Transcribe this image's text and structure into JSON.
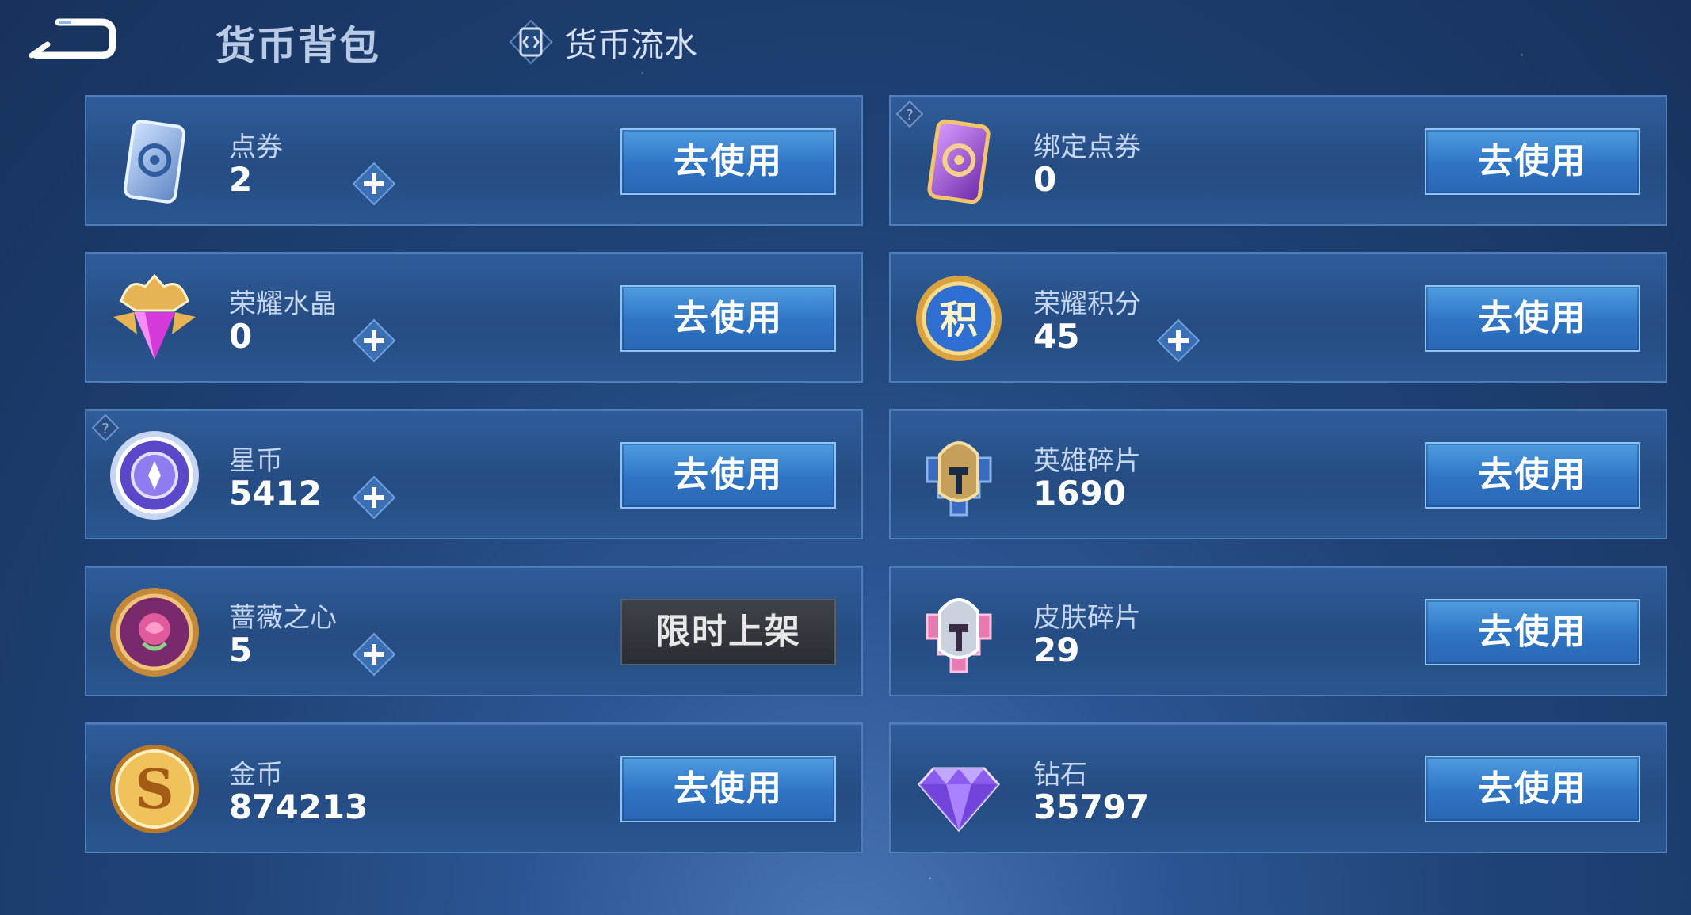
{
  "header": {
    "title": "货币背包",
    "flow_tab_label": "货币流水"
  },
  "button_labels": {
    "use": "去使用",
    "limited": "限时上架"
  },
  "currencies": [
    {
      "name": "点券",
      "amount": "2",
      "icon": "coupon-icon",
      "has_plus": true,
      "action": "use",
      "has_help": false
    },
    {
      "name": "绑定点券",
      "amount": "0",
      "icon": "bound-coupon-icon",
      "has_plus": false,
      "action": "use",
      "has_help": true
    },
    {
      "name": "荣耀水晶",
      "amount": "0",
      "icon": "glory-crystal-icon",
      "has_plus": true,
      "action": "use",
      "has_help": false
    },
    {
      "name": "荣耀积分",
      "amount": "45",
      "icon": "glory-points-icon",
      "has_plus": true,
      "action": "use",
      "has_help": false
    },
    {
      "name": "星币",
      "amount": "5412",
      "icon": "star-coin-icon",
      "has_plus": true,
      "action": "use",
      "has_help": true
    },
    {
      "name": "英雄碎片",
      "amount": "1690",
      "icon": "hero-fragment-icon",
      "has_plus": false,
      "action": "use",
      "has_help": false
    },
    {
      "name": "蔷薇之心",
      "amount": "5",
      "icon": "rose-heart-icon",
      "has_plus": true,
      "action": "limited",
      "has_help": false
    },
    {
      "name": "皮肤碎片",
      "amount": "29",
      "icon": "skin-fragment-icon",
      "has_plus": false,
      "action": "use",
      "has_help": false
    },
    {
      "name": "金币",
      "amount": "874213",
      "icon": "gold-coin-icon",
      "has_plus": false,
      "action": "use",
      "has_help": false
    },
    {
      "name": "钻石",
      "amount": "35797",
      "icon": "diamond-icon",
      "has_plus": false,
      "action": "use",
      "has_help": false
    }
  ],
  "colors": {
    "background": "#1f4276",
    "card": "#2a5690",
    "use_button": "#2f74c4",
    "limited_button": "#2a2d33"
  }
}
